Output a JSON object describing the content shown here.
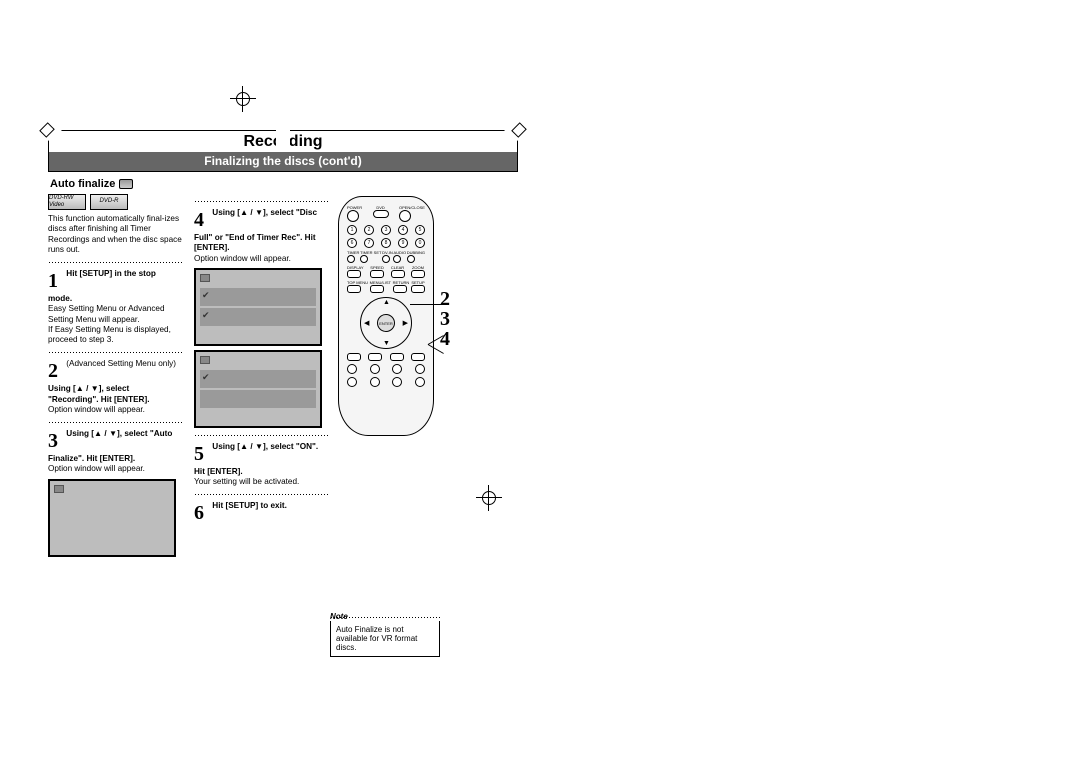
{
  "header": {
    "title": "Recording",
    "subtitle": "Finalizing the discs (cont'd)"
  },
  "section": {
    "heading": "Auto finalize"
  },
  "formats": {
    "a": "DVD-RW Video",
    "b": "DVD-R"
  },
  "intro": "This function automatically final-izes discs after finishing all Timer Recordings and when the disc space runs out.",
  "step1": {
    "num": "1",
    "bold": "Hit [SETUP] in the stop mode.",
    "body1": "Easy Setting Menu or Advanced Setting Menu will appear.",
    "body2": "If Easy Setting Menu is displayed, proceed to step 3."
  },
  "step2": {
    "num": "2",
    "note": "(Advanced Setting Menu only)",
    "bold": "Using [▲ / ▼], select \"Recording\". Hit [ENTER].",
    "body": "Option window will appear."
  },
  "step3": {
    "num": "3",
    "bold": "Using [▲ / ▼], select \"Auto Finalize\". Hit [ENTER].",
    "body": "Option window will appear."
  },
  "step4": {
    "num": "4",
    "bold": "Using [▲ / ▼], select \"Disc Full\" or \"End of Timer Rec\". Hit [ENTER].",
    "body": "Option window will appear."
  },
  "step5": {
    "num": "5",
    "bold": "Using [▲ / ▼], select \"ON\". Hit [ENTER].",
    "body": "Your setting will be activated."
  },
  "step6": {
    "num": "6",
    "bold": "Hit [SETUP] to exit."
  },
  "remote": {
    "topLabels": {
      "l": "POWER",
      "c": "DVD",
      "r": "OPEN/CLOSE"
    },
    "row4": {
      "a": "TIMER",
      "b": "TIMER SET",
      "c": "DV-IN",
      "d": "AUDIO",
      "e": "DUBBING"
    },
    "row5": {
      "a": "DISPLAY",
      "b": "SPEED",
      "c": "CLEAR",
      "d": "ZOOM"
    },
    "row6": {
      "a": "TOP MENU",
      "b": "MENU/LIST",
      "c": "RETURN",
      "d": "SETUP"
    },
    "enter": "ENTER"
  },
  "callouts": {
    "a": "2",
    "b": "3",
    "c": "4"
  },
  "note": {
    "label": "Note",
    "text": "Auto Finalize is not available for VR format discs."
  }
}
